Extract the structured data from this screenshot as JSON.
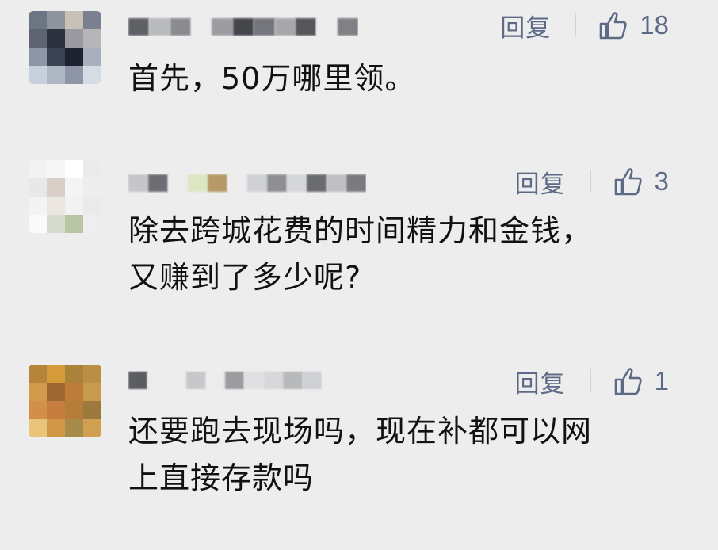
{
  "comments": [
    {
      "text": "首先，50万哪里领。",
      "reply_label": "回复",
      "likes": "18",
      "avatar_colors": [
        "#6b7584",
        "#8e939e",
        "#c8c1b8",
        "#7a808f",
        "#5f6473",
        "#2d3140",
        "#9a9aa0",
        "#b7b5b8",
        "#8c96a8",
        "#3b4252",
        "#1f2230",
        "#a8b0bf",
        "#c8d0dd",
        "#b0b7c4",
        "#8d95a6",
        "#d6dbe4"
      ],
      "name_colors": [
        "#5f6066",
        "#b9babd",
        "#8a8b90",
        "#ececec",
        "#9c9da2",
        "#45464b",
        "#75767b",
        "#a6a7ab",
        "#555659",
        "#ececec",
        "#808186"
      ]
    },
    {
      "text": "除去跨城花费的时间精力和金钱，\n又赚到了多少呢?",
      "reply_label": "回复",
      "likes": "3",
      "avatar_colors": [
        "#f2f2f2",
        "#f6f6f6",
        "#ffffff",
        "#ebebeb",
        "#e8e8e8",
        "#d9cfc8",
        "#f4f4f4",
        "#ededed",
        "#f3f3f3",
        "#ebe6e2",
        "#f2f2f2",
        "#eaeaea",
        "#fafafa",
        "#d8dcd0",
        "#b9c6a6",
        "#eeeeee"
      ],
      "name_colors": [
        "#c5c6c9",
        "#6d6e73",
        "#ececec",
        "#dde6c2",
        "#b59967",
        "#ececec",
        "#cfd0d3",
        "#8e8f94",
        "#d5d6d9",
        "#6a6b70",
        "#bfc0c3",
        "#7a7b80"
      ]
    },
    {
      "text": "还要跑去现场吗，现在补都可以网\n上直接存款吗",
      "reply_label": "回复",
      "likes": "1",
      "avatar_colors": [
        "#b5853c",
        "#d59a3a",
        "#a88339",
        "#ba8f45",
        "#d29a4a",
        "#9c6733",
        "#bf7c39",
        "#c89b4c",
        "#d28f47",
        "#c57e3f",
        "#b57c3a",
        "#9c7a3e",
        "#e9c47a",
        "#cf9746",
        "#a78b4a",
        "#d1a051"
      ],
      "name_colors": [
        "#5c5d61",
        "#ececec",
        "#ececec",
        "#c7c8cb",
        "#ececec",
        "#9b9ca0",
        "#e0e0e2",
        "#d7d8db",
        "#b8b9bc",
        "#cfd0d3"
      ]
    }
  ],
  "colors": {
    "background": "#ededed",
    "text": "#111111",
    "meta": "#5d6a86",
    "divider": "#cfd3db"
  },
  "icons": {
    "like": "thumb-up-outline-icon"
  }
}
